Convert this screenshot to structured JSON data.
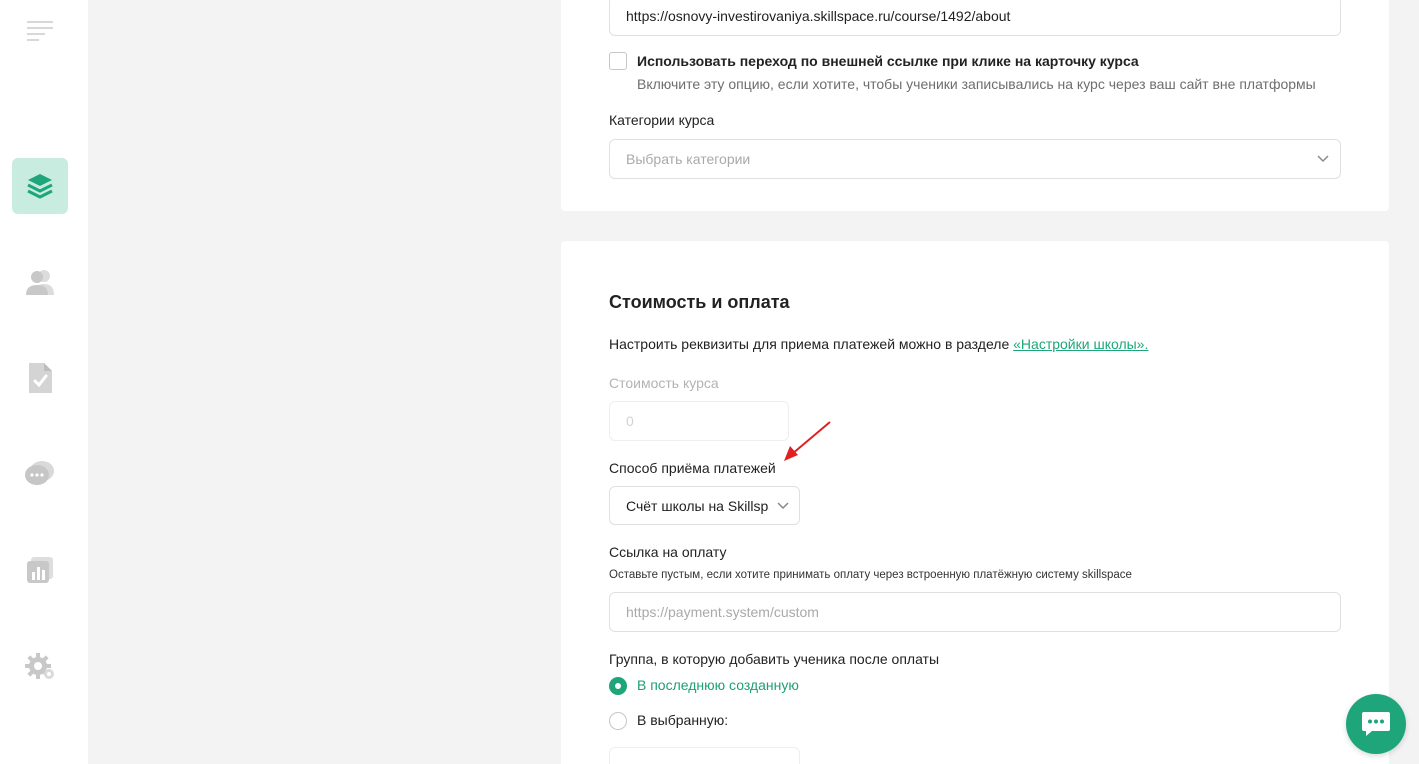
{
  "sidebar": {
    "items": [
      {
        "name": "courses",
        "icon": "layers-icon",
        "active": true
      },
      {
        "name": "users",
        "icon": "users-icon",
        "active": false
      },
      {
        "name": "homework",
        "icon": "document-check-icon",
        "active": false
      },
      {
        "name": "chats",
        "icon": "chat-icon",
        "active": false
      },
      {
        "name": "analytics",
        "icon": "chart-icon",
        "active": false
      },
      {
        "name": "settings",
        "icon": "gear-icon",
        "active": false
      }
    ]
  },
  "course_card": {
    "url_value": "https://osnovy-investirovaniya.skillspace.ru/course/1492/about",
    "external_link_label": "Использовать переход по внешней ссылке при клике на карточку курса",
    "external_link_hint": "Включите эту опцию, если хотите, чтобы ученики записывались на курс через ваш сайт вне платформы",
    "categories_label": "Категории курса",
    "categories_placeholder": "Выбрать категории"
  },
  "payment_card": {
    "title": "Стоимость и оплата",
    "intro_text": "Настроить реквизиты для приема платежей можно в разделе ",
    "intro_link": "«Настройки школы».",
    "price_label": "Стоимость курса",
    "price_value": "0",
    "method_label": "Способ приёма платежей",
    "method_value": "Счёт школы на Skillspace",
    "payment_link_label": "Ссылка на оплату",
    "payment_link_hint": "Оставьте пустым, если хотите принимать оплату через встроенную платёжную систему skillspace",
    "payment_link_placeholder": "https://payment.system/custom",
    "group_label": "Группа, в которую добавить ученика после оплаты",
    "group_options": [
      "В последнюю созданную",
      "В выбранную:"
    ]
  },
  "colors": {
    "accent": "#1ea67a",
    "active_bg": "#c9ece0",
    "arrow": "#e02020"
  }
}
